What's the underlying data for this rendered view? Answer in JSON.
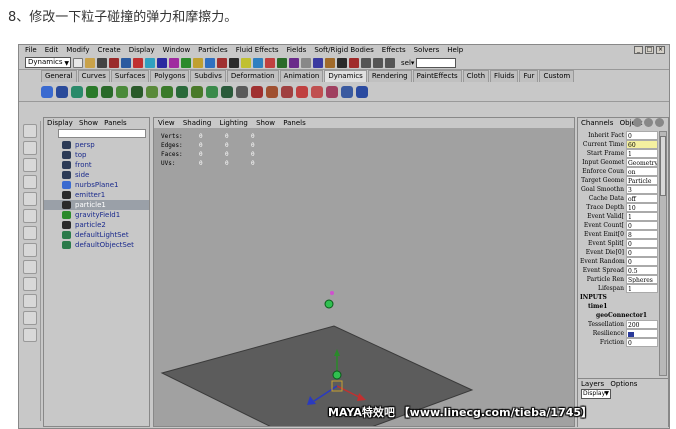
{
  "caption": "8、修改一下粒子碰撞的弹力和摩擦力。",
  "menubar": [
    "File",
    "Edit",
    "Modify",
    "Create",
    "Display",
    "Window",
    "Particles",
    "Fluid Effects",
    "Fields",
    "Soft/Rigid Bodies",
    "Effects",
    "Solvers",
    "Help"
  ],
  "mode": "Dynamics",
  "sel_label": "sel▾",
  "shelf_tabs": [
    "General",
    "Curves",
    "Surfaces",
    "Polygons",
    "Subdivs",
    "Deformation",
    "Animation",
    "Dynamics",
    "Rendering",
    "PaintEffects",
    "Cloth",
    "Fluids",
    "Fur",
    "Custom"
  ],
  "active_shelf_tab": "Dynamics",
  "outliner": {
    "menu": [
      "Display",
      "Show",
      "Panels"
    ],
    "items": [
      {
        "label": "persp",
        "icon": "camera-icon",
        "color": "#2b3a55",
        "selected": false
      },
      {
        "label": "top",
        "icon": "camera-icon",
        "color": "#2b3a55",
        "selected": false
      },
      {
        "label": "front",
        "icon": "camera-icon",
        "color": "#2b3a55",
        "selected": false
      },
      {
        "label": "side",
        "icon": "camera-icon",
        "color": "#2b3a55",
        "selected": false
      },
      {
        "label": "nurbsPlane1",
        "icon": "plane-icon",
        "color": "#3a6ad0",
        "selected": false
      },
      {
        "label": "emitter1",
        "icon": "emitter-icon",
        "color": "#2a2a2a",
        "selected": false
      },
      {
        "label": "particle1",
        "icon": "particle-icon",
        "color": "#2a2a2a",
        "selected": true
      },
      {
        "label": "gravityField1",
        "icon": "field-icon",
        "color": "#2a8a2a",
        "selected": false
      },
      {
        "label": "particle2",
        "icon": "particle-icon",
        "color": "#2a2a2a",
        "selected": false
      },
      {
        "label": "defaultLightSet",
        "icon": "set-icon",
        "color": "#2a7a4a",
        "selected": false
      },
      {
        "label": "defaultObjectSet",
        "icon": "set-icon",
        "color": "#2a7a4a",
        "selected": false
      }
    ]
  },
  "viewport": {
    "menu": [
      "View",
      "Shading",
      "Lighting",
      "Show",
      "Panels"
    ],
    "hud": [
      {
        "label": "Verts:",
        "values": [
          "0",
          "0",
          "0"
        ]
      },
      {
        "label": "Edges:",
        "values": [
          "0",
          "0",
          "0"
        ]
      },
      {
        "label": "Faces:",
        "values": [
          "0",
          "0",
          "0"
        ]
      },
      {
        "label": "UVs:",
        "values": [
          "0",
          "0",
          "0"
        ]
      }
    ]
  },
  "channel_box": {
    "menu": [
      "Channels",
      "Object"
    ],
    "attributes": [
      {
        "name": "Inherit Fact",
        "value": "0",
        "highlight": false
      },
      {
        "name": "Current Time",
        "value": "60",
        "highlight": true
      },
      {
        "name": "Start Frame",
        "value": "1",
        "highlight": false
      },
      {
        "name": "Input Geomet",
        "value": "Geometry",
        "highlight": false
      },
      {
        "name": "Enforce Coun",
        "value": "on",
        "highlight": false
      },
      {
        "name": "Target Geome",
        "value": "Particle",
        "highlight": false
      },
      {
        "name": "Goal Smoothn",
        "value": "3",
        "highlight": false
      },
      {
        "name": "Cache Data",
        "value": "off",
        "highlight": false
      },
      {
        "name": "Trace Depth",
        "value": "10",
        "highlight": false
      },
      {
        "name": "Event Valid[",
        "value": "1",
        "highlight": false
      },
      {
        "name": "Event Count[",
        "value": "0",
        "highlight": false
      },
      {
        "name": "Event Emit[0",
        "value": "8",
        "highlight": false
      },
      {
        "name": "Event Split[",
        "value": "0",
        "highlight": false
      },
      {
        "name": "Event Die[0]",
        "value": "0",
        "highlight": false
      },
      {
        "name": "Event Random",
        "value": "0",
        "highlight": false
      },
      {
        "name": "Event Spread",
        "value": "0.5",
        "highlight": false
      },
      {
        "name": "Particle Ren",
        "value": "Spheres",
        "highlight": false
      },
      {
        "name": "Lifespan",
        "value": "1",
        "highlight": false
      }
    ],
    "inputs_label": "INPUTS",
    "inputs": [
      "time1",
      "geoConnector1"
    ],
    "geo_attrs": [
      {
        "name": "Tessellation",
        "value": "200"
      },
      {
        "name": "Resilience",
        "value": ""
      },
      {
        "name": "Friction",
        "value": "0"
      }
    ]
  },
  "layers": {
    "menu": [
      "Layers",
      "Options"
    ],
    "select": "Display"
  },
  "watermark": "MAYA特效吧 【www.linecg.com/tieba/1745】",
  "colors": {
    "viewport_bg": "#a1a1a1",
    "ground_plane": "#5c5c5c",
    "selection": "#9aa0a8",
    "highlight_field": "#f4f0a0"
  }
}
